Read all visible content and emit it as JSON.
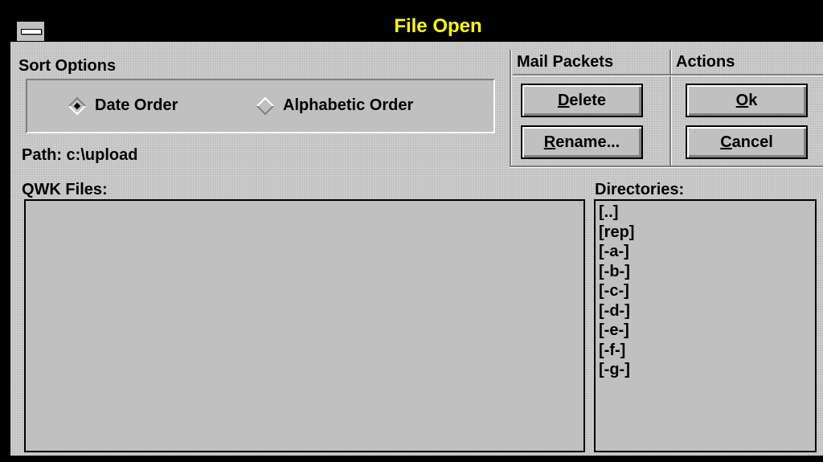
{
  "window": {
    "title": "File Open"
  },
  "sort_options": {
    "heading": "Sort Options",
    "options": [
      {
        "label": "Date Order",
        "selected": true
      },
      {
        "label": "Alphabetic Order",
        "selected": false
      }
    ]
  },
  "path_label": "Path: c:\\upload",
  "mail_packets": {
    "heading": "Mail Packets",
    "delete_prefix": "D",
    "delete_rest": "elete",
    "rename_prefix": "R",
    "rename_rest": "ename..."
  },
  "actions": {
    "heading": "Actions",
    "ok_prefix": "O",
    "ok_rest": "k",
    "cancel_prefix": "C",
    "cancel_rest": "ancel"
  },
  "qwk_files": {
    "heading": "QWK Files:",
    "items": []
  },
  "directories": {
    "heading": "Directories:",
    "items": [
      "[..]",
      "[rep]",
      "[-a-]",
      "[-b-]",
      "[-c-]",
      "[-d-]",
      "[-e-]",
      "[-f-]",
      "[-g-]"
    ]
  },
  "colors": {
    "title_text": "#ffff00",
    "face": "#c0c0c0",
    "frame": "#000000"
  }
}
